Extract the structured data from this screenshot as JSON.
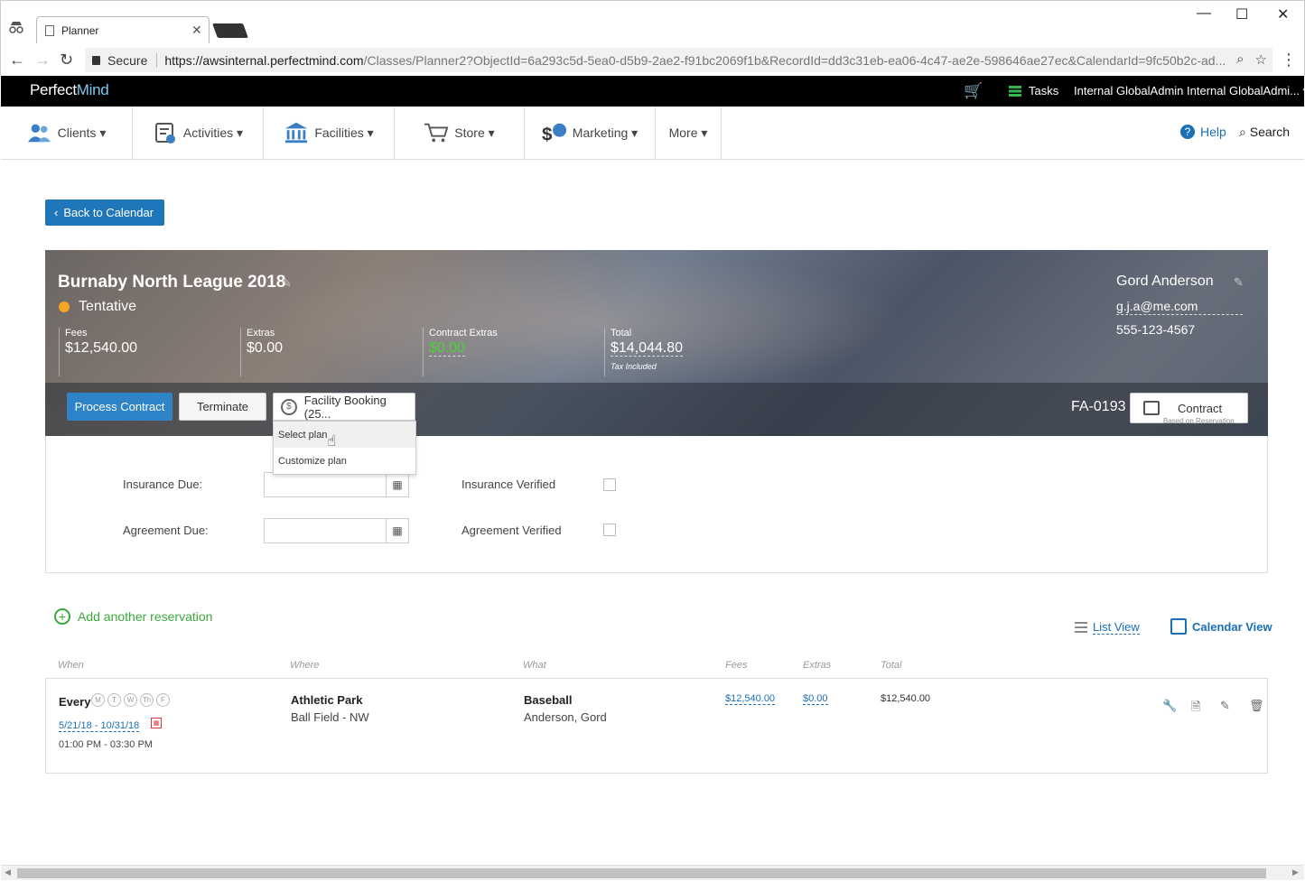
{
  "browser": {
    "tab_title": "Planner",
    "secure_label": "Secure",
    "url_host": "https://awsinternal.perfectmind.com",
    "url_rest": "/Classes/Planner2?ObjectId=6a293c5d-5ea0-d5b9-2ae2-f91bc2069f1b&RecordId=dd3c31eb-ea06-4c47-ae2e-598646ae27ec&CalendarId=9fc50b2c-ad..."
  },
  "appbar": {
    "logo_a": "Perfect",
    "logo_b": "Mind",
    "tasks_label": "Tasks",
    "user_label": "Internal GlobalAdmin Internal GlobalAdmi..."
  },
  "nav": {
    "items": [
      {
        "label": "Clients ▾"
      },
      {
        "label": "Activities ▾"
      },
      {
        "label": "Facilities ▾"
      },
      {
        "label": "Store ▾"
      },
      {
        "label": "Marketing ▾"
      },
      {
        "label": "More ▾"
      }
    ],
    "help_label": "Help",
    "search_label": "Search"
  },
  "back_label": "Back to Calendar",
  "event": {
    "title": "Burnaby North League 2018",
    "status": "Tentative",
    "status_color": "#f5a623",
    "stats": [
      {
        "label": "Fees",
        "value": "$12,540.00"
      },
      {
        "label": "Extras",
        "value": "$0.00"
      },
      {
        "label": "Contract Extras",
        "value": "$0.00"
      },
      {
        "label": "Total",
        "value": "$14,044.80",
        "note": "Tax Included"
      }
    ],
    "contact": {
      "name": "Gord Anderson",
      "email": "g.j.a@me.com",
      "phone": "555-123-4567"
    },
    "process_label": "Process Contract",
    "terminate_label": "Terminate",
    "plan_label": "Facility Booking (25...",
    "fa_number": "FA-0193",
    "contract_label": "Contract",
    "contract_sub": "Based on Reservation"
  },
  "plan_dropdown": {
    "items": [
      "Select plan",
      "Customize plan"
    ]
  },
  "form": {
    "insurance_due_label": "Insurance Due:",
    "agreement_due_label": "Agreement Due:",
    "insurance_verified_label": "Insurance Verified",
    "agreement_verified_label": "Agreement Verified"
  },
  "reservations": {
    "add_label": "Add another reservation",
    "list_view_label": "List View",
    "calendar_view_label": "Calendar View",
    "headers": {
      "when": "When",
      "where": "Where",
      "what": "What",
      "fees": "Fees",
      "extras": "Extras",
      "total": "Total"
    },
    "rows": [
      {
        "every": "Every",
        "days": [
          "M",
          "T",
          "W",
          "Th",
          "F"
        ],
        "dates": "5/21/18 - 10/31/18",
        "times": "01:00 PM - 03:30 PM",
        "where_name": "Athletic Park",
        "where_sub": "Ball Field - NW",
        "what_name": "Baseball",
        "what_sub": "Anderson, Gord",
        "fees": "$12,540.00",
        "extras": "$0.00",
        "total": "$12,540.00"
      }
    ]
  }
}
